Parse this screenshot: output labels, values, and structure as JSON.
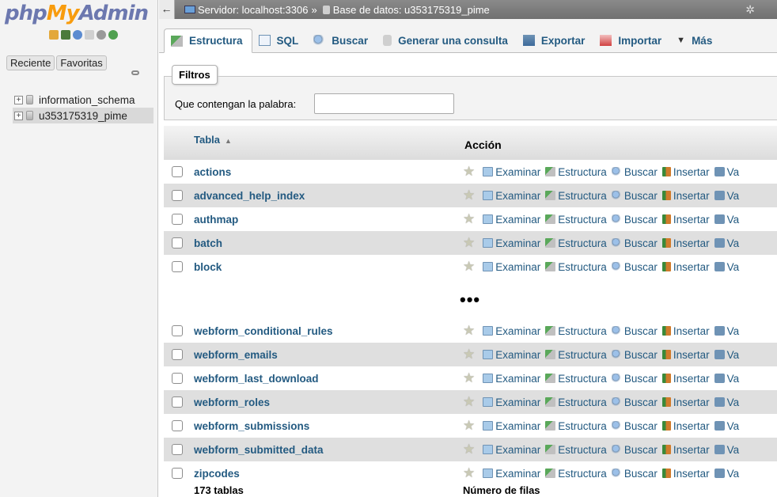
{
  "nav": {
    "logo": {
      "part1": "php",
      "part2": "My",
      "part3": "Admin"
    },
    "icons": [
      "home-icon",
      "database-icon",
      "info-icon",
      "docs-icon",
      "settings-icon",
      "reload-icon"
    ],
    "recent_label": "Reciente",
    "favorites_label": "Favoritas",
    "databases": [
      {
        "name": "information_schema"
      },
      {
        "name": "u353175319_pime"
      }
    ]
  },
  "breadcrumb": {
    "back": "←",
    "server": "Servidor: localhost:3306",
    "sep": "»",
    "database": "Base de datos: u353175319_pime"
  },
  "tabs": [
    {
      "label": "Estructura",
      "icon": "structure-icon",
      "active": true
    },
    {
      "label": "SQL",
      "icon": "sql-icon"
    },
    {
      "label": "Buscar",
      "icon": "search-icon"
    },
    {
      "label": "Generar una consulta",
      "icon": "query-icon"
    },
    {
      "label": "Exportar",
      "icon": "export-icon"
    },
    {
      "label": "Importar",
      "icon": "import-icon"
    },
    {
      "label": "Más",
      "icon": "more-icon"
    }
  ],
  "filters": {
    "legend": "Filtros",
    "label": "Que contengan la palabra:",
    "value": "",
    "placeholder": ""
  },
  "table": {
    "col_table": "Tabla",
    "col_sort": "▲",
    "col_action": "Acción",
    "actions": {
      "browse": "Examinar",
      "structure": "Estructura",
      "search": "Buscar",
      "insert": "Insertar",
      "empty": "Va"
    },
    "rows_top": [
      "actions",
      "advanced_help_index",
      "authmap",
      "batch",
      "block"
    ],
    "ellipsis": "•••",
    "rows_bottom": [
      "webform_conditional_rules",
      "webform_emails",
      "webform_last_download",
      "webform_roles",
      "webform_submissions",
      "webform_submitted_data",
      "zipcodes"
    ],
    "footer_count": "173 tablas",
    "footer_rows": "Número de filas"
  }
}
